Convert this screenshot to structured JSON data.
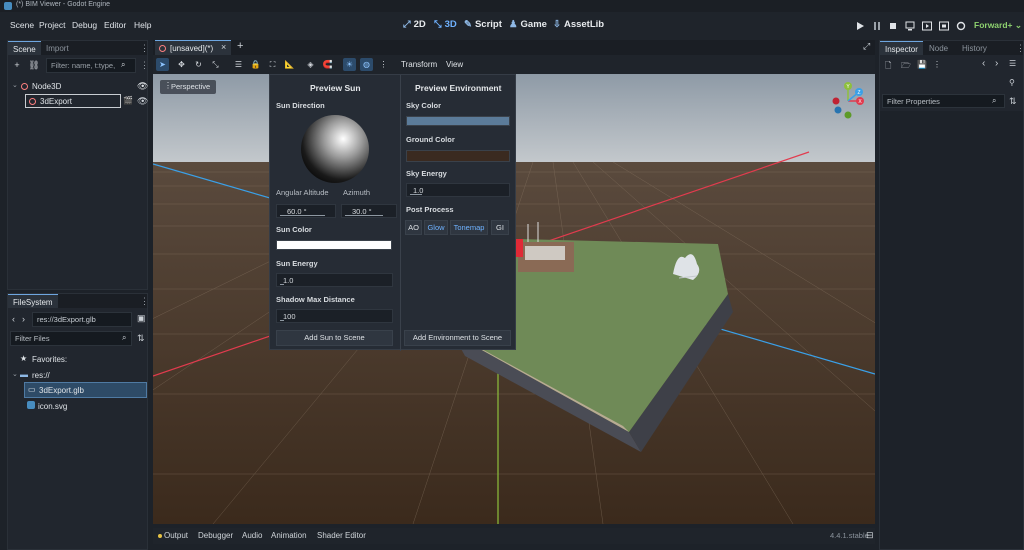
{
  "window": {
    "title": "(*) BIM Viewer - Godot Engine"
  },
  "menu": [
    "Scene",
    "Project",
    "Debug",
    "Editor",
    "Help"
  ],
  "workspaces": [
    {
      "icon": "2d-icon",
      "label": "2D"
    },
    {
      "icon": "3d-icon",
      "label": "3D",
      "active": true
    },
    {
      "icon": "script-icon",
      "label": "Script"
    },
    {
      "icon": "game-icon",
      "label": "Game"
    },
    {
      "icon": "assetlib-icon",
      "label": "AssetLib"
    }
  ],
  "renderer": "Forward+",
  "scene_dock": {
    "tabs": [
      "Scene",
      "Import"
    ],
    "filter_placeholder": "Filter: name, t:type,",
    "tree": [
      {
        "label": "Node3D",
        "depth": 0
      },
      {
        "label": "3dExport",
        "depth": 1,
        "selected": true
      }
    ]
  },
  "filesystem": {
    "tab": "FileSystem",
    "path": "res://3dExport.glb",
    "filter_placeholder": "Filter Files",
    "favorites_label": "Favorites:",
    "root": "res://",
    "files": [
      {
        "label": "3dExport.glb",
        "selected": true
      },
      {
        "label": "icon.svg"
      }
    ]
  },
  "editor_tabs": [
    {
      "label": "[unsaved](*)"
    }
  ],
  "viewport": {
    "menus": [
      "Transform",
      "View"
    ],
    "perspective_label": "Perspective"
  },
  "preview_sun": {
    "title": "Preview Sun",
    "direction_label": "Sun Direction",
    "altitude_label": "Angular Altitude",
    "azimuth_label": "Azimuth",
    "altitude_value": "60.0 °",
    "azimuth_value": "30.0 °",
    "color_label": "Sun Color",
    "energy_label": "Sun Energy",
    "energy_value": "1.0",
    "shadow_label": "Shadow Max Distance",
    "shadow_value": "100",
    "add_button": "Add Sun to Scene"
  },
  "preview_env": {
    "title": "Preview Environment",
    "sky_color_label": "Sky Color",
    "ground_color_label": "Ground Color",
    "sky_energy_label": "Sky Energy",
    "sky_energy_value": "1.0",
    "post_process_label": "Post Process",
    "post_buttons": [
      {
        "label": "AO",
        "on": false
      },
      {
        "label": "Glow",
        "on": true
      },
      {
        "label": "Tonemap",
        "on": true
      },
      {
        "label": "GI",
        "on": false
      }
    ],
    "add_button": "Add Environment to Scene"
  },
  "inspector": {
    "tabs": [
      "Inspector",
      "Node",
      "History"
    ],
    "filter_placeholder": "Filter Properties"
  },
  "bottom_tabs": [
    "Output",
    "Debugger",
    "Audio",
    "Animation",
    "Shader Editor"
  ],
  "version": "4.4.1.stable",
  "gizmo_axes": [
    "Y",
    "X",
    "Z"
  ],
  "colors": {
    "accent": "#6fb2ff",
    "node_icon": "#fc7f7f",
    "sky_color": "#5b7b99",
    "ground_color": "#3a2a20",
    "renderer": "#8ed16f"
  }
}
